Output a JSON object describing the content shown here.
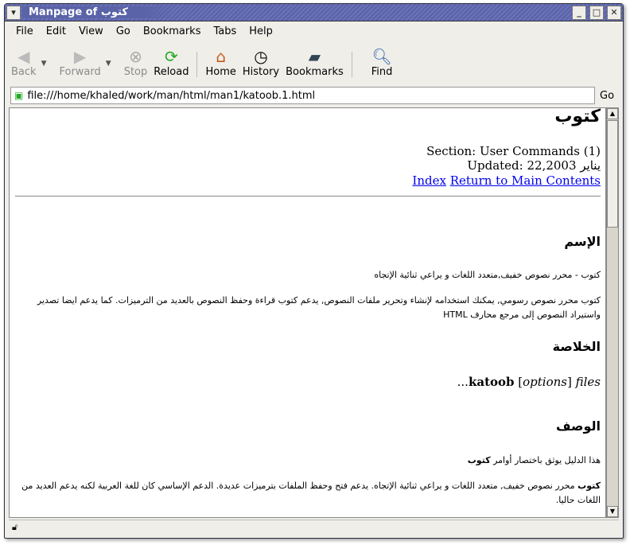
{
  "window": {
    "title": "Manpage of كتوب"
  },
  "menu": [
    "File",
    "Edit",
    "View",
    "Go",
    "Bookmarks",
    "Tabs",
    "Help"
  ],
  "toolbar": {
    "back": "Back",
    "forward": "Forward",
    "stop": "Stop",
    "reload": "Reload",
    "home": "Home",
    "history": "History",
    "bookmarks": "Bookmarks",
    "find": "Find"
  },
  "address": {
    "value": "file:///home/khaled/work/man/html/man1/katoob.1.html",
    "go": "Go"
  },
  "page": {
    "title": "كتوب",
    "section": "Section: User Commands (1)",
    "updated": "Updated: يناير 22,2003",
    "links": {
      "index": "Index",
      "main": "Return to Main Contents"
    },
    "name_heading": "الإسم",
    "name_text": "كتوب - محرر نصوص خفيف,متعدد اللغات و يراعي ثنائية الإتجاه",
    "name_para": "كتوب محرر نصوص رسومي, يمكنك استخدامه لإنشاء وتحرير ملفات النصوص, يدعم كتوب قراءة وحفظ النصوص بالعديد من الترميزات. كما يدعم ايضا تصدير واستيراد النصوص إلى مرجع محارف HTML",
    "synopsis_heading": "الخلاصة",
    "synopsis": {
      "cmd": "katoob",
      "opt": "options",
      "files": "files",
      "ellipsis": "..."
    },
    "desc_heading": "الوصف",
    "desc_text": "هذا الدليل يوثق باختصار أوامر",
    "desc_bold": "كتوب",
    "desc_para_bold": "كتوب",
    "desc_para": "محرر نصوص خفيف, متعدد اللغات و يراعي ثنائية الإتجاه. يدعم فتح وحفظ الملفات بترميزات عديدة. الدعم الإساسي كان للغة العربية لكنه يدعم العديد من اللغات حاليا."
  }
}
